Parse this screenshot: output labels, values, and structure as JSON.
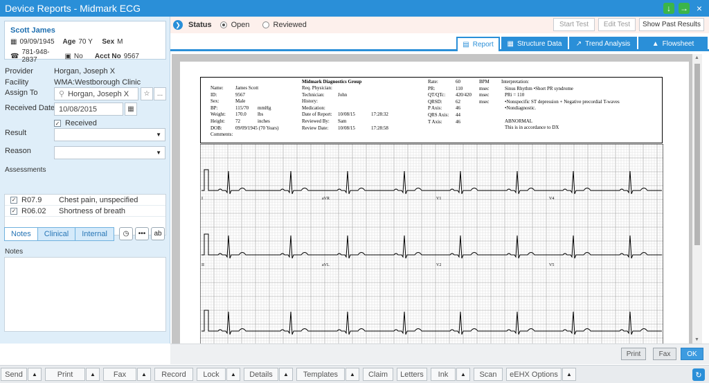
{
  "window": {
    "title": "Device Reports - Midmark ECG"
  },
  "patient": {
    "name": "Scott James",
    "dob": "09/09/1945",
    "age_label": "Age",
    "age": "70 Y",
    "sex_label": "Sex",
    "sex": "M",
    "phone": "781-948-2837",
    "portal": "No",
    "acct_label": "Acct No",
    "acct": "9567"
  },
  "form": {
    "provider_label": "Provider",
    "provider": "Horgan, Joseph X",
    "facility_label": "Facility",
    "facility": "WMA:Westborough Clinic",
    "assign_label": "Assign To",
    "assign": "Horgan, Joseph X",
    "received_date_label": "Received Date",
    "received_date": "10/08/2015",
    "received_label": "Received",
    "result_label": "Result",
    "reason_label": "Reason",
    "assessments_label": "Assessments",
    "assessments": [
      {
        "code": "R07.9",
        "desc": "Chest pain, unspecified"
      },
      {
        "code": "R06.02",
        "desc": "Shortness of breath"
      }
    ],
    "tabs": [
      "Notes",
      "Clinical",
      "Internal"
    ],
    "notes_label": "Notes",
    "more": "•••"
  },
  "status": {
    "label": "Status",
    "options": [
      "Open",
      "Reviewed"
    ],
    "start_test": "Start Test",
    "edit_test": "Edit Test",
    "show_past": "Show Past Results"
  },
  "report_tabs": [
    "Report",
    "Structure Data",
    "Trend Analysis",
    "Flowsheet"
  ],
  "ecg": {
    "group": "Midmark Diagnostics Group",
    "col1": [
      [
        "Name:",
        "James Scott"
      ],
      [
        "ID:",
        "9567"
      ],
      [
        "Sex:",
        "Male"
      ],
      [
        "BP:",
        "115/70",
        "mmHg"
      ],
      [
        "Weight:",
        "170.0",
        "lbs"
      ],
      [
        "Height:",
        "72",
        "inches"
      ],
      [
        "DOB:",
        "09/09/1945 (70 Years)"
      ],
      [
        "Comments:",
        ""
      ]
    ],
    "col2": [
      [
        "Req. Physician:",
        ""
      ],
      [
        "Technician:",
        "John"
      ],
      [
        "History:",
        ""
      ],
      [
        "Medication:",
        ""
      ],
      [
        "Date of Report:",
        "10/08/15",
        "17:28:32"
      ],
      [
        "Reviewed By:",
        "Sam"
      ],
      [
        "Review Date:",
        "10/08/15",
        "17:28:58"
      ]
    ],
    "col3": [
      [
        "Rate:",
        "60",
        "BPM"
      ],
      [
        "PR:",
        "110",
        "msec"
      ],
      [
        "QT/QTc:",
        "420/420",
        "msec"
      ],
      [
        "QRSD:",
        "62",
        "msec"
      ],
      [
        "P Axis:",
        "46",
        ""
      ],
      [
        "QRS Axis:",
        "44",
        ""
      ],
      [
        "T Axis:",
        "46",
        ""
      ]
    ],
    "interp_title": "Interpretation:",
    "interp": [
      "Sinus Rhythm  •Short PR syndrome",
      "PRi = 110",
      "•Nonspecific ST depression  +  Negative precordial T-waves",
      "•Nondiagnostic.",
      "",
      "ABNORMAL",
      "This is in accordance to DX"
    ],
    "leads_row1": [
      "I",
      "aVR",
      "V1",
      "V4"
    ],
    "leads_row2": [
      "II",
      "aVL",
      "V2",
      "V5"
    ]
  },
  "footer_buttons": {
    "print": "Print",
    "fax": "Fax",
    "ok": "OK"
  },
  "toolbar": [
    "Send",
    "Print",
    "Fax",
    "Record",
    "Lock",
    "Details",
    "Templates",
    "Claim",
    "Letters",
    "Ink",
    "Scan",
    "eEHX Options"
  ]
}
